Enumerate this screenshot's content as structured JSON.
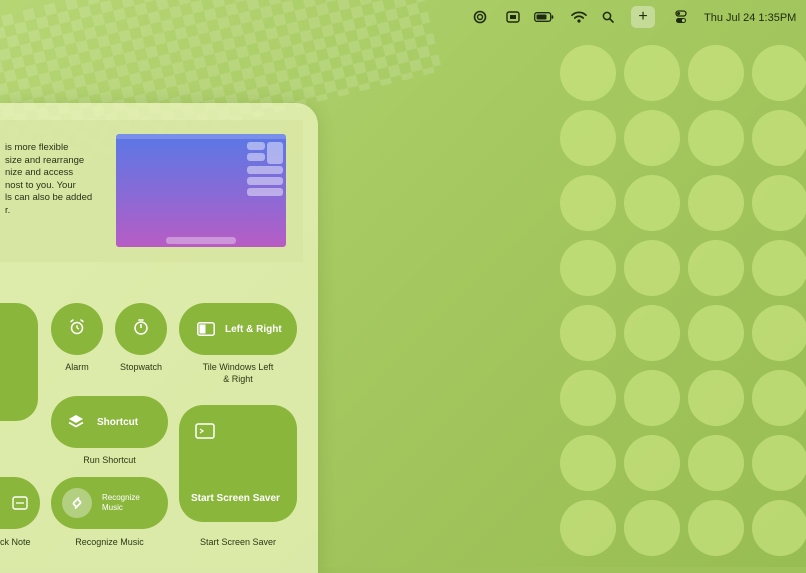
{
  "menubar": {
    "icons": [
      "creative-cloud-icon",
      "display-icon",
      "battery-icon",
      "wifi-icon",
      "search-icon",
      "add-icon",
      "control-center-icon"
    ],
    "add_label": "+",
    "clock": "Thu Jul 24 1:35PM"
  },
  "panel": {
    "banner_heading": "",
    "banner_lines": [
      "is more flexible",
      "size and rearrange",
      "nize and access",
      "nost to you. Your",
      "ls can also be added",
      "r."
    ],
    "controls": {
      "alarm_label": "Alarm",
      "stopwatch_label": "Stopwatch",
      "tile_button": "Left & Right",
      "tile_caption_1": "Tile Windows Left",
      "tile_caption_2": "& Right",
      "shortcut_button": "Shortcut",
      "shortcut_caption": "Run Shortcut",
      "recognize_button_1": "Recognize",
      "recognize_button_2": "Music",
      "recognize_caption": "Recognize Music",
      "screensaver_button": "Start Screen Saver",
      "screensaver_caption": "Start Screen Saver",
      "quicknote_caption": "ck Note"
    }
  },
  "colors": {
    "accent": "#8bb63c",
    "desktop": "#a6c961",
    "panel": "#ebf4bc"
  }
}
